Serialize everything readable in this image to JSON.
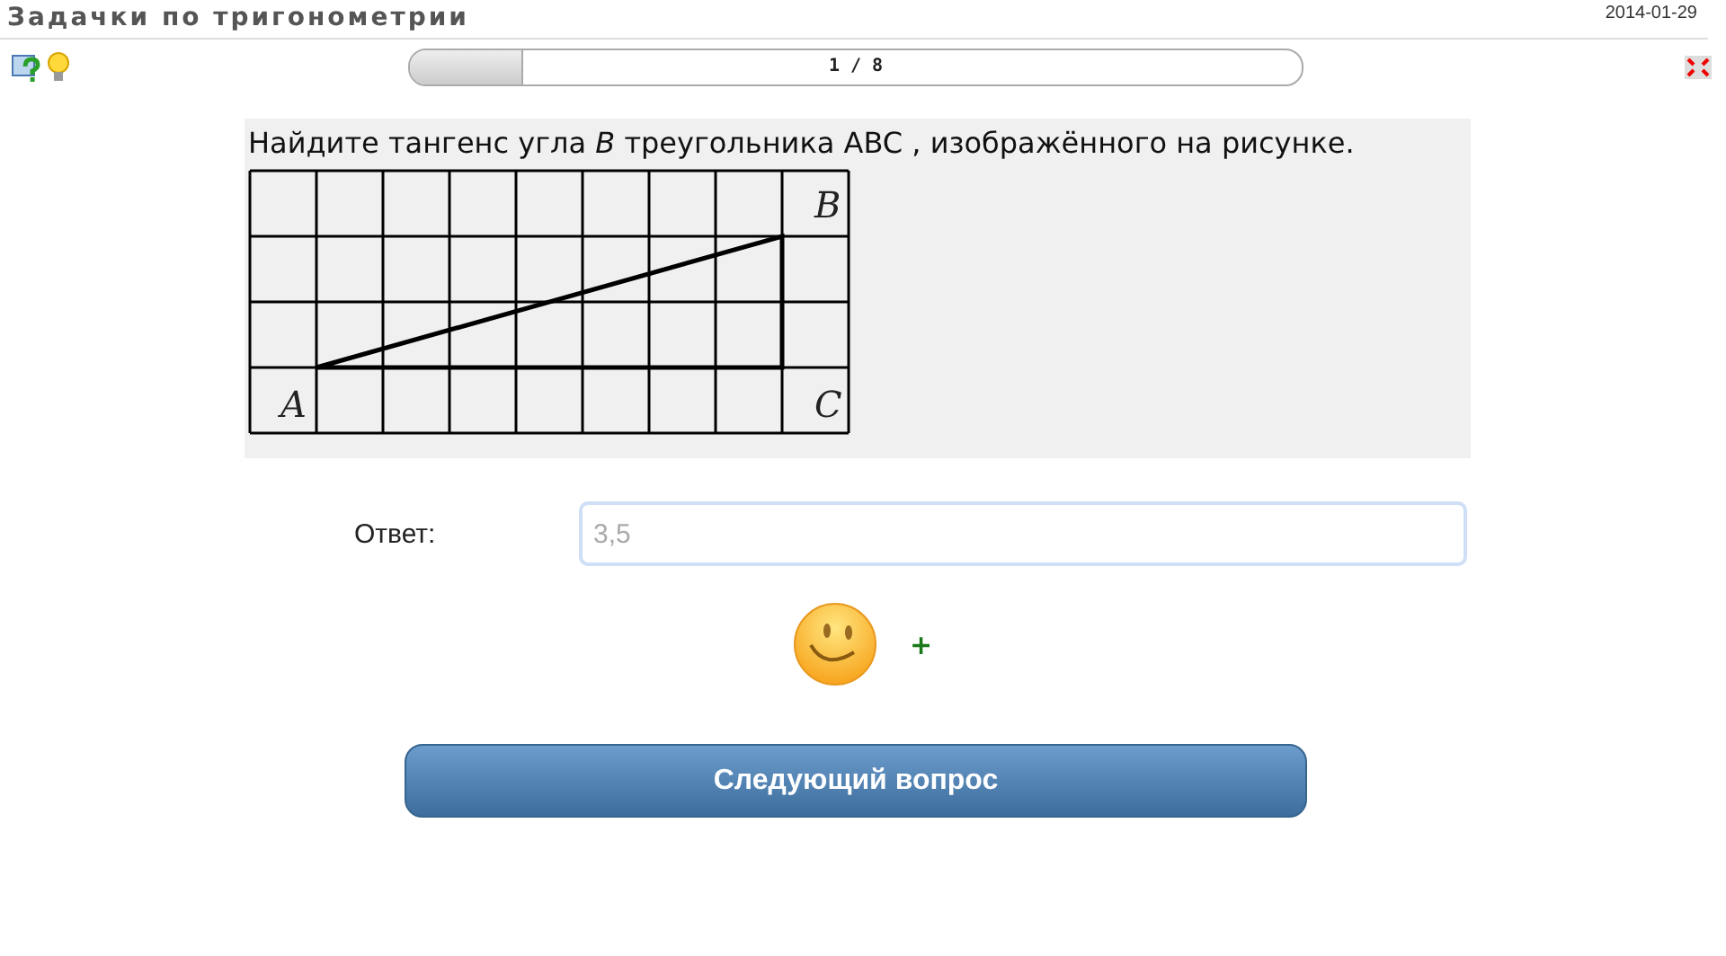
{
  "header": {
    "title": "Задачки по тригонометрии",
    "date": "2014-01-29"
  },
  "progress": {
    "label": "1 / 8",
    "level": 0.125
  },
  "question": {
    "text": "Найдите тангенс угла *B* треугольника ABC , изображённого на рисунке.",
    "figure": {
      "vertex_labels": [
        "B",
        "A",
        "C"
      ]
    }
  },
  "answer": {
    "label": "Ответ:",
    "value": "3,5"
  },
  "feedback": {
    "mark": "+"
  },
  "buttons": [
    "Следующий вопрос"
  ]
}
